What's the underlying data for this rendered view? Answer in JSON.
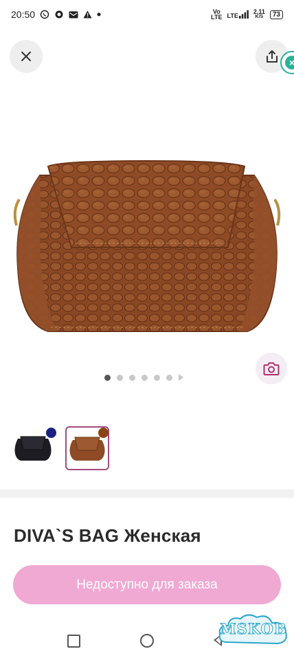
{
  "status_bar": {
    "time": "20:50",
    "left_icons": [
      "viber-icon",
      "whatsapp-icon",
      "mail-icon",
      "warning-icon",
      "dot-icon"
    ],
    "network_top": "Vo",
    "network_bottom": "LTE",
    "lte": "LTE",
    "speed_top": "2,11",
    "speed_bottom": "K/S",
    "battery": "73"
  },
  "toolbar": {
    "close_icon": "close-icon",
    "share_icon": "share-icon"
  },
  "gallery": {
    "dots_total": 6,
    "active_index": 0
  },
  "variants": [
    {
      "color_name": "navy",
      "swatch": "#1a237e",
      "bag_color": "#1c1c22",
      "selected": false
    },
    {
      "color_name": "brown",
      "swatch": "#8b4513",
      "bag_color": "#8e4b26",
      "selected": true
    }
  ],
  "product": {
    "title": "DIVA`S BAG Женская"
  },
  "order_button": {
    "label": "Недоступно для заказа"
  },
  "watermark": {
    "text": "MSKOB"
  },
  "colors": {
    "accent_pink": "#f0a9d3",
    "selected_border": "#a24a82",
    "leather_brown": "#8e4b26"
  }
}
